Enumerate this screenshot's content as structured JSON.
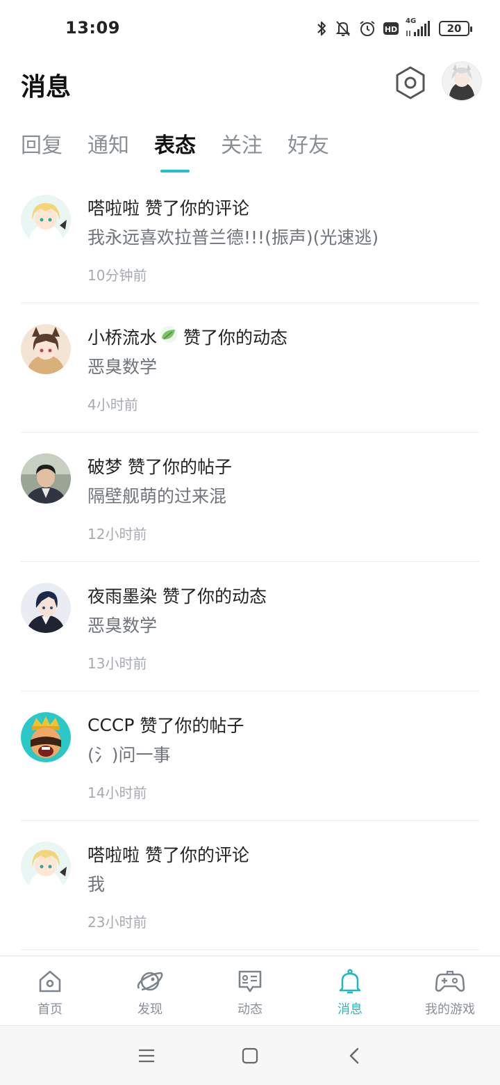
{
  "status_bar": {
    "time": "13:09",
    "network": "4G",
    "battery": "20",
    "icons": [
      "bluetooth-icon",
      "mute-bell-icon",
      "alarm-icon",
      "hd-icon",
      "signal-icon",
      "battery-icon"
    ]
  },
  "header": {
    "title": "消息"
  },
  "tabs": [
    {
      "label": "回复",
      "active": false
    },
    {
      "label": "通知",
      "active": false
    },
    {
      "label": "表态",
      "active": true
    },
    {
      "label": "关注",
      "active": false
    },
    {
      "label": "好友",
      "active": false
    }
  ],
  "messages": [
    {
      "user": "嗒啦啦",
      "action": "赞了你的评论",
      "content": "我永远喜欢拉普兰德!!!(振声)(光速逃)",
      "time": "10分钟前",
      "has_badge": false
    },
    {
      "user": "小桥流水",
      "action": "赞了你的动态",
      "content": "恶臭数学",
      "time": "4小时前",
      "has_badge": true
    },
    {
      "user": "破梦",
      "action": "赞了你的帖子",
      "content": "隔壁舰萌的过来混",
      "time": "12小时前",
      "has_badge": false
    },
    {
      "user": "夜雨墨染",
      "action": "赞了你的动态",
      "content": "恶臭数学",
      "time": "13小时前",
      "has_badge": false
    },
    {
      "user": "CCCP",
      "action": "赞了你的帖子",
      "content": "(氵)问一事",
      "time": "14小时前",
      "has_badge": false
    },
    {
      "user": "嗒啦啦",
      "action": "赞了你的评论",
      "content": "我",
      "time": "23小时前",
      "has_badge": false
    }
  ],
  "bottom_nav": [
    {
      "label": "首页",
      "icon": "home-icon",
      "active": false
    },
    {
      "label": "发现",
      "icon": "planet-icon",
      "active": false
    },
    {
      "label": "动态",
      "icon": "feed-icon",
      "active": false
    },
    {
      "label": "消息",
      "icon": "bell-icon",
      "active": true
    },
    {
      "label": "我的游戏",
      "icon": "gamepad-icon",
      "active": false
    }
  ],
  "colors": {
    "accent": "#21C1C7",
    "text_primary": "#222222",
    "text_secondary": "#6F737A",
    "text_muted": "#A6AAB0"
  }
}
